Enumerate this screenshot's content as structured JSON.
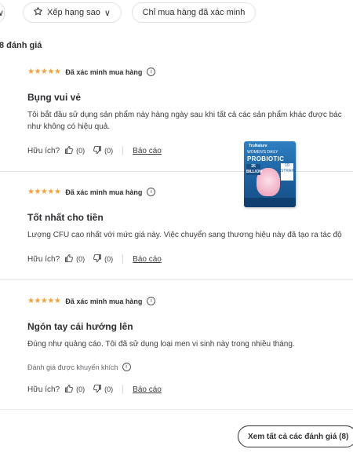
{
  "filters": {
    "partial_chevron": "∨",
    "rating_label": "Xếp hạng sao",
    "rating_chevron": "∨",
    "verified_label": "Chỉ mua hàng đã xác minh"
  },
  "summary": "8 đánh giá",
  "reviews": [
    {
      "stars": "★★★★★",
      "verified": "Đã xác minh mua hàng",
      "title": "Bụng vui vẻ",
      "body": "Tôi bắt đầu sử dụng sản phẩm này hàng ngày sau khi tất cả các sản phẩm khác được bác như không có hiệu quả.",
      "helpful_label": "Hữu ích?",
      "up_count": "(0)",
      "down_count": "(0)",
      "report": "Báo cáo"
    },
    {
      "stars": "★★★★★",
      "verified": "Đã xác minh mua hàng",
      "title": "Tốt nhất cho tiền",
      "body": "Lượng CFU cao nhất với mức giá này. Việc chuyển sang thương hiệu này đã tạo ra tác độ",
      "helpful_label": "Hữu ích?",
      "up_count": "(0)",
      "down_count": "(0)",
      "report": "Báo cáo"
    },
    {
      "stars": "★★★★★",
      "verified": "Đã xác minh mua hàng",
      "title": "Ngón tay cái hướng lên",
      "body": "Đúng như quảng cáo. Tôi đã sử dụng loại men vi sinh này trong nhiều tháng.",
      "badge": "Đánh giá được khuyến khích",
      "helpful_label": "Hữu ích?",
      "up_count": "(0)",
      "down_count": "(0)",
      "report": "Báo cáo"
    }
  ],
  "product_image": {
    "brand": "TruNature",
    "line1": "WOMEN'S DAILY",
    "line2": "PROBIOTIC",
    "cfu": "25 BILLION",
    "panel": "10 STRAINS"
  },
  "see_all": "Xem tất cả các đánh giá (8)"
}
